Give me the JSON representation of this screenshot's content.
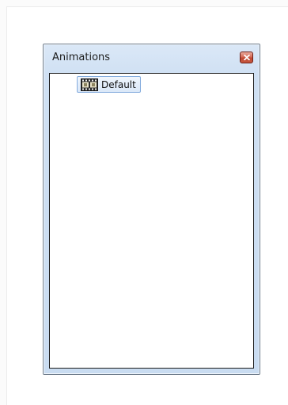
{
  "panel": {
    "title": "Animations",
    "close_icon": "close-icon"
  },
  "tree": {
    "items": [
      {
        "label": "Default",
        "icon": "film-strip-icon",
        "selected": true
      }
    ]
  },
  "colors": {
    "panel_background": "#cfe0f3",
    "close_button": "#c14a34",
    "selection_border": "#84acdd"
  }
}
